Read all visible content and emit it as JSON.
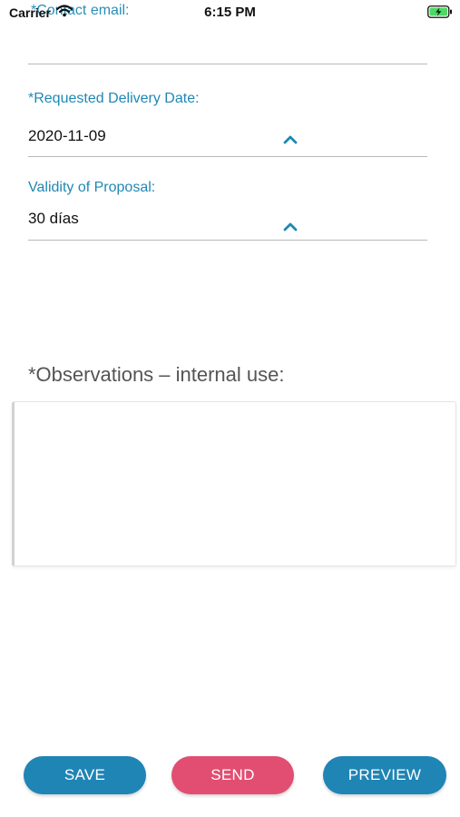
{
  "status_bar": {
    "carrier": "Carrier",
    "time": "6:15 PM",
    "wifi_icon": "wifi-icon",
    "battery_icon": "battery-charging-icon"
  },
  "form": {
    "contact_email": {
      "label": "*Contact email:"
    },
    "delivery_date": {
      "label": "*Requested Delivery Date:",
      "value": "2020-11-09",
      "icon": "chevron-up-icon"
    },
    "validity": {
      "label": "Validity of Proposal:",
      "value": "30 días",
      "icon": "chevron-up-icon"
    },
    "observations": {
      "label": "*Observations – internal use:",
      "value": ""
    }
  },
  "actions": {
    "save_label": "SAVE",
    "send_label": "SEND",
    "preview_label": "PREVIEW"
  },
  "colors": {
    "accent_blue": "#1e85b5",
    "label_blue": "#1e88b4",
    "send_pink": "#e24e72",
    "chevron": "#1e88b4"
  }
}
